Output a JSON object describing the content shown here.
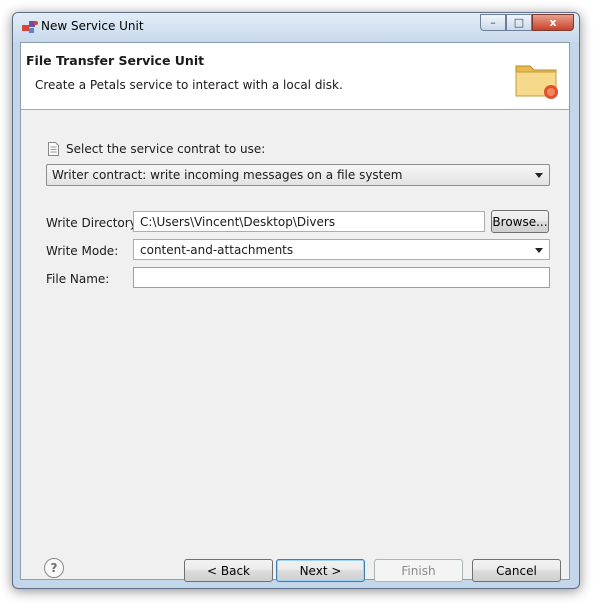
{
  "window": {
    "title": "New Service Unit",
    "controls": {
      "minimize": "–",
      "maximize": "□",
      "close": "x"
    }
  },
  "header": {
    "title": "File Transfer Service Unit",
    "description": "Create a Petals service to interact with a local disk.",
    "icon": "folder-icon"
  },
  "contract": {
    "label": "Select the service contrat to use:",
    "selected": "Writer contract: write incoming messages on a file system"
  },
  "form": {
    "write_directory": {
      "label": "Write Directory:",
      "value": "C:\\Users\\Vincent\\Desktop\\Divers",
      "browse_label": "Browse..."
    },
    "write_mode": {
      "label": "Write Mode:",
      "selected": "content-and-attachments"
    },
    "file_name": {
      "label": "File Name:",
      "value": ""
    }
  },
  "footer": {
    "help": "?",
    "back": "< Back",
    "next": "Next >",
    "finish": "Finish",
    "cancel": "Cancel"
  },
  "colors": {
    "frame": "#c4d6ea",
    "dialog_bg": "#f0f0f0",
    "header_bg": "#ffffff",
    "default_button_border": "#3c7fb1",
    "close_button": "#c7432a"
  }
}
